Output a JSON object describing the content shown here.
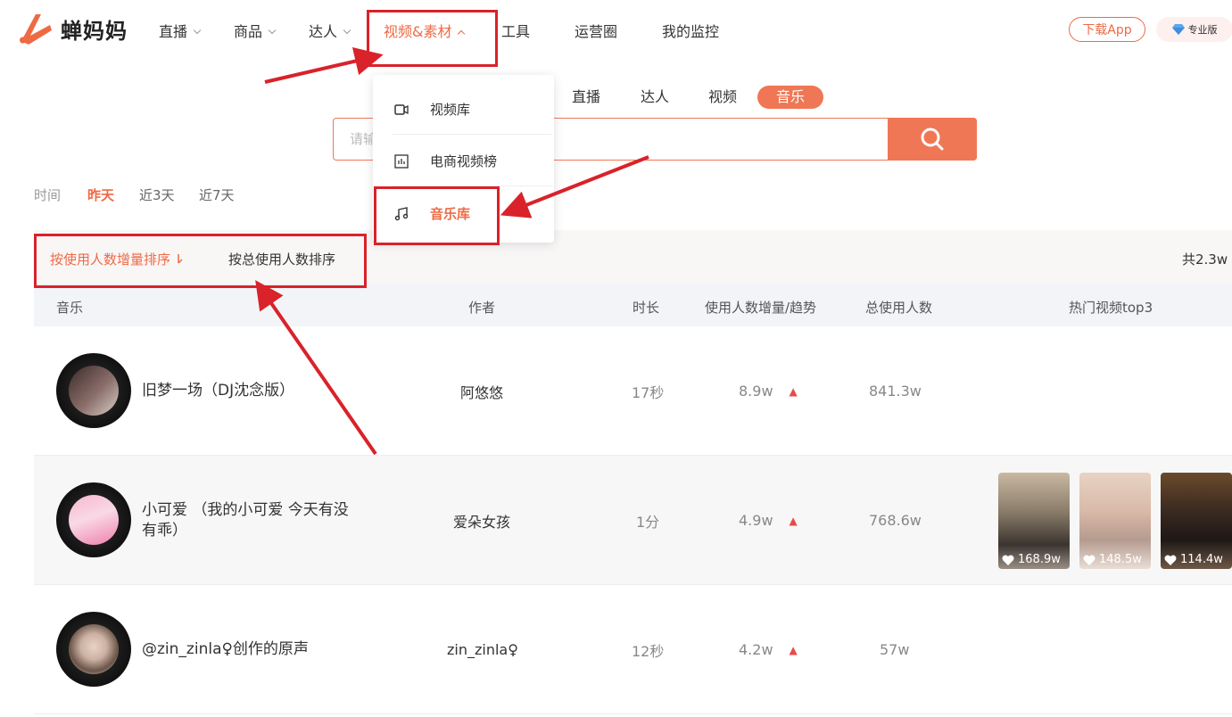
{
  "app": {
    "name": "蝉妈妈"
  },
  "nav": {
    "items": [
      {
        "label": "直播",
        "dropdown": true
      },
      {
        "label": "商品",
        "dropdown": true
      },
      {
        "label": "达人",
        "dropdown": true
      },
      {
        "label": "视频&素材",
        "dropdown": true,
        "active": true
      },
      {
        "label": "工具",
        "dropdown": false
      },
      {
        "label": "运营圈",
        "dropdown": false
      },
      {
        "label": "我的监控",
        "dropdown": false
      }
    ],
    "download_label": "下载App",
    "pro_label": "专业版"
  },
  "dropdown": {
    "items": [
      {
        "label": "视频库",
        "icon": "video-icon"
      },
      {
        "label": "电商视频榜",
        "icon": "chart-icon"
      },
      {
        "label": "音乐库",
        "icon": "music-icon",
        "active": true
      }
    ]
  },
  "subtabs": [
    {
      "label": "直播"
    },
    {
      "label": "达人"
    },
    {
      "label": "视频"
    },
    {
      "label": "音乐",
      "active": true
    }
  ],
  "search": {
    "placeholder": "请输",
    "value": ""
  },
  "time_filter": {
    "label": "时间",
    "options": [
      {
        "label": "昨天",
        "active": true
      },
      {
        "label": "近3天"
      },
      {
        "label": "近7天"
      }
    ]
  },
  "sort": {
    "options": [
      {
        "label": "按使用人数增量排序",
        "active": true
      },
      {
        "label": "按总使用人数排序"
      }
    ],
    "total": "共2.3w"
  },
  "table": {
    "columns": [
      "音乐",
      "作者",
      "时长",
      "使用人数增量/趋势",
      "总使用人数",
      "热门视频top3"
    ],
    "rows": [
      {
        "name": "旧梦一场（DJ沈念版）",
        "author": "阿悠悠",
        "duration": "17秒",
        "increase": "8.9w",
        "trend": "up",
        "total": "841.3w",
        "videos": []
      },
      {
        "name": "小可爱 （我的小可爱 今天有没有乖）",
        "author": "爱朵女孩",
        "duration": "1分",
        "increase": "4.9w",
        "trend": "up",
        "total": "768.6w",
        "videos": [
          {
            "likes": "168.9w"
          },
          {
            "likes": "148.5w"
          },
          {
            "likes": "114.4w"
          }
        ]
      },
      {
        "name": "@zin_zinla♀创作的原声",
        "author": "zin_zinla♀",
        "duration": "12秒",
        "increase": "4.2w",
        "trend": "up",
        "total": "57w",
        "videos": []
      }
    ]
  },
  "colors": {
    "accent": "#ee6a45",
    "annotation": "#d9222a",
    "trend_up": "#e84a4a"
  }
}
